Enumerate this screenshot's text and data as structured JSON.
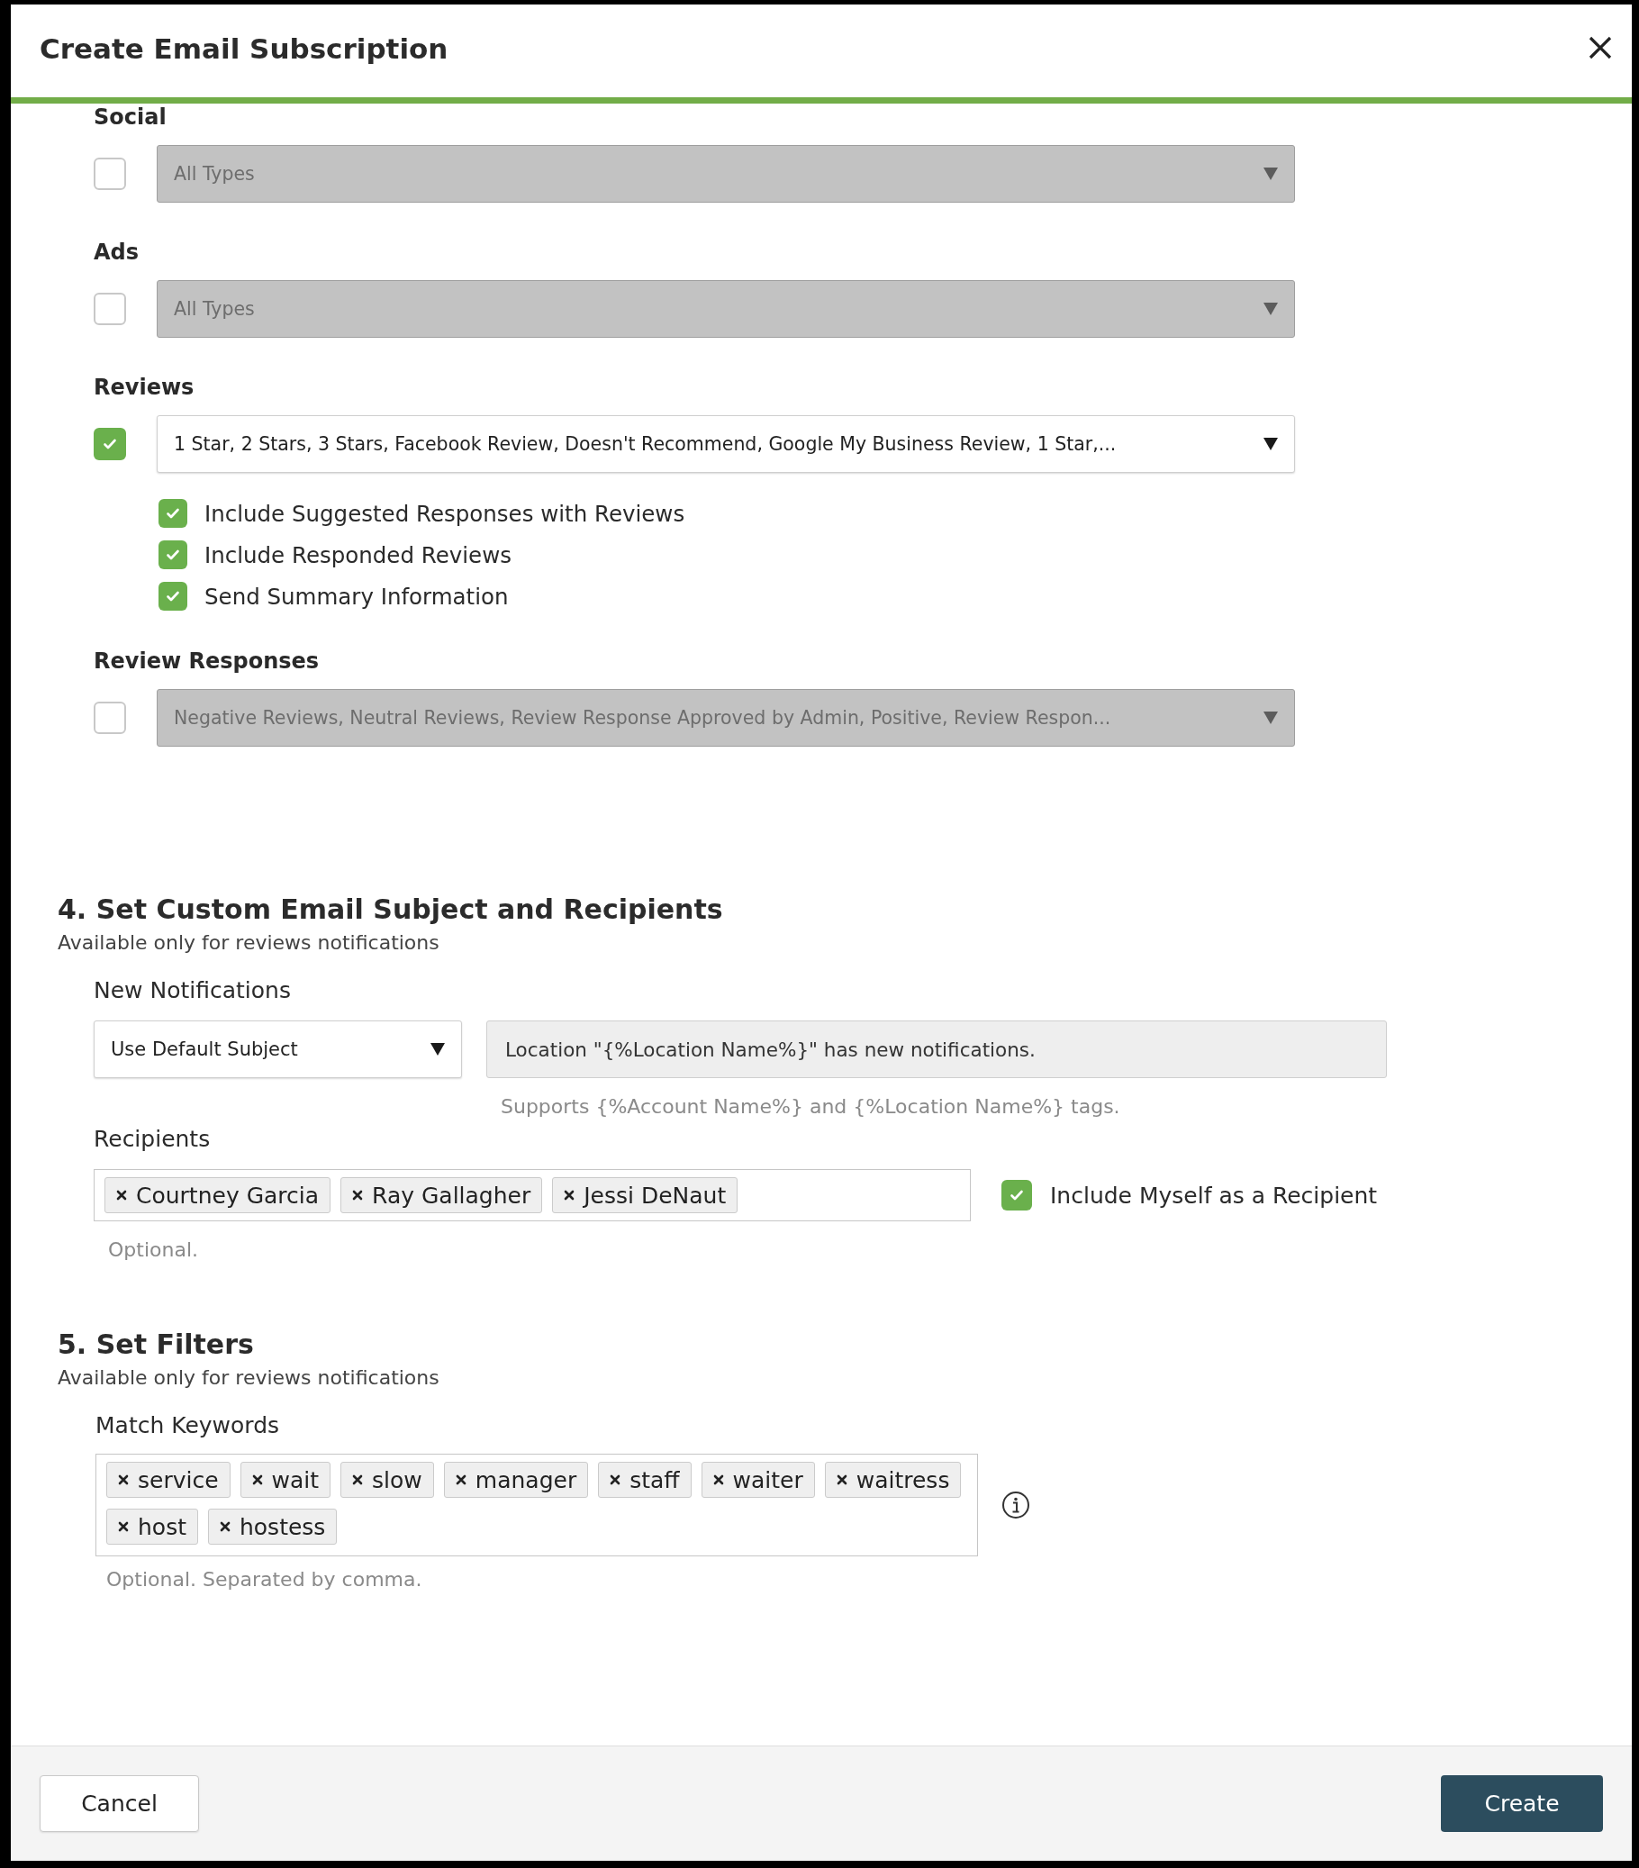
{
  "dialog": {
    "title": "Create Email Subscription"
  },
  "categories": [
    {
      "label": "Social",
      "checked": false,
      "select": {
        "value": "All Types",
        "disabled": true
      }
    },
    {
      "label": "Ads",
      "checked": false,
      "select": {
        "value": "All Types",
        "disabled": true
      }
    },
    {
      "label": "Reviews",
      "checked": true,
      "select": {
        "value": "1 Star, 2 Stars, 3 Stars, Facebook Review, Doesn't Recommend, Google My Business Review, 1 Star,...",
        "disabled": false
      },
      "options": [
        {
          "label": "Include Suggested Responses with Reviews",
          "checked": true
        },
        {
          "label": "Include Responded Reviews",
          "checked": true
        },
        {
          "label": "Send Summary Information",
          "checked": true
        }
      ]
    },
    {
      "label": "Review Responses",
      "checked": false,
      "select": {
        "value": "Negative Reviews, Neutral Reviews, Review Response Approved by Admin, Positive, Review Respon...",
        "disabled": true
      }
    }
  ],
  "section_4": {
    "heading": "4. Set Custom Email Subject and Recipients",
    "subtitle": "Available only for reviews notifications",
    "new_notifications": {
      "label": "New Notifications",
      "subject_select": "Use Default Subject",
      "subject_field": {
        "value": "Location \"{%Location Name%}\" has new notifications.",
        "disabled": true
      },
      "hint": "Supports {%Account Name%} and {%Location Name%} tags."
    },
    "recipients": {
      "label": "Recipients",
      "tags": [
        "Courtney Garcia",
        "Ray Gallagher",
        "Jessi DeNaut"
      ],
      "hint": "Optional.",
      "include_myself": {
        "label": "Include Myself as a Recipient",
        "checked": true
      }
    }
  },
  "section_5": {
    "heading": "5. Set Filters",
    "subtitle": "Available only for reviews notifications",
    "match_keywords": {
      "label": "Match Keywords",
      "tags": [
        "service",
        "wait",
        "slow",
        "manager",
        "staff",
        "waiter",
        "waitress",
        "host",
        "hostess"
      ],
      "hint": "Optional. Separated by comma."
    }
  },
  "footer": {
    "cancel": "Cancel",
    "create": "Create"
  }
}
